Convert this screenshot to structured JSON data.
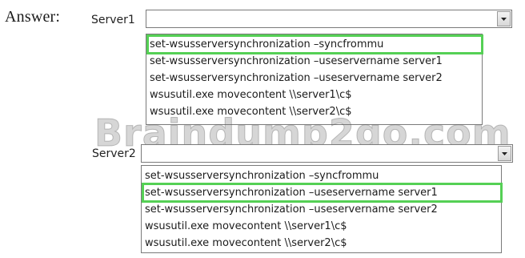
{
  "answer_label": "Answer:",
  "watermark": "Braindump2go.com",
  "server1": {
    "label": "Server1",
    "value": "",
    "options": [
      "set-wsusserversynchronization –syncfrommu",
      "set-wsusserversynchronization –useservername server1",
      "set-wsusserversynchronization –useservername server2",
      "wsusutil.exe movecontent \\\\server1\\c$",
      "wsusutil.exe movecontent \\\\server2\\c$"
    ],
    "selected_index": 0
  },
  "server2": {
    "label": "Server2",
    "value": "",
    "options": [
      "set-wsusserversynchronization –syncfrommu",
      "set-wsusserversynchronization –useservername server1",
      "set-wsusserversynchronization –useservername server2",
      "wsusutil.exe movecontent \\\\server1\\c$",
      "wsusutil.exe movecontent \\\\server2\\c$"
    ],
    "selected_index": 1
  },
  "highlight_color": "#55d055",
  "icons": {
    "dropdown": "chevron-down-icon"
  }
}
